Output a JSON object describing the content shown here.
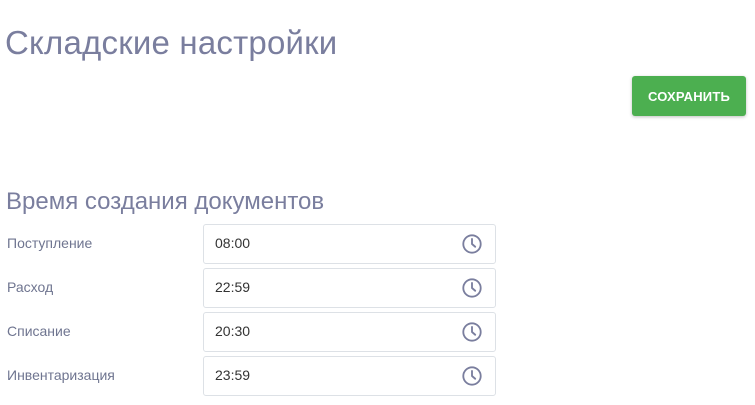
{
  "header": {
    "title": "Складские настройки"
  },
  "toolbar": {
    "save_label": "СОХРАНИТЬ"
  },
  "section": {
    "title": "Время создания документов",
    "rows": [
      {
        "label": "Поступление",
        "value": "08:00",
        "icon": "clock-icon"
      },
      {
        "label": "Расход",
        "value": "22:59",
        "icon": "clock-icon"
      },
      {
        "label": "Списание",
        "value": "20:30",
        "icon": "clock-icon"
      },
      {
        "label": "Инвентаризация",
        "value": "23:59",
        "icon": "clock-icon"
      }
    ]
  },
  "colors": {
    "accent": "#4caf50",
    "title": "#7a7e9e",
    "icon": "#7a7e9e"
  }
}
